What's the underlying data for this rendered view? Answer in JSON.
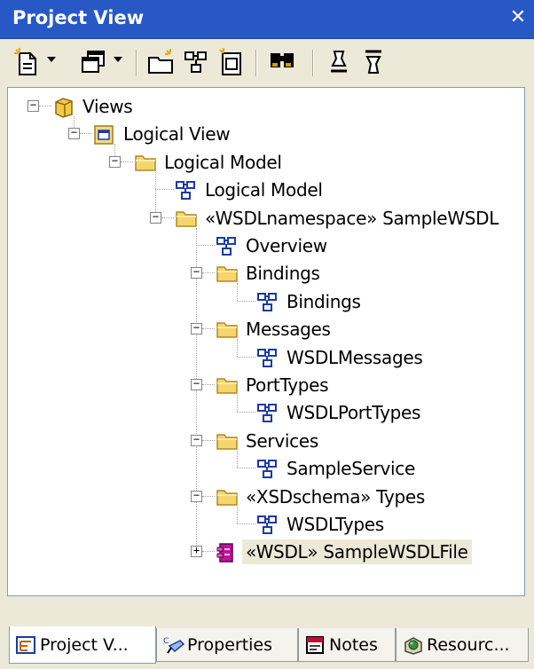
{
  "window": {
    "title": "Project View",
    "close_glyph": "✕"
  },
  "toolbar": {
    "items": [
      {
        "icon": "new-document-icon"
      },
      {
        "icon": "windows-icon"
      },
      {
        "icon": "new-package-icon"
      },
      {
        "icon": "new-diagram-icon"
      },
      {
        "icon": "new-element-icon"
      },
      {
        "icon": "find-icon"
      },
      {
        "icon": "move-up-icon"
      },
      {
        "icon": "move-down-icon"
      }
    ]
  },
  "tree": {
    "nodes": [
      {
        "label": "Views",
        "icon": "views-package-icon",
        "expander": "minus"
      },
      {
        "label": "Logical View",
        "icon": "logical-view-icon",
        "expander": "minus"
      },
      {
        "label": "Logical Model",
        "icon": "folder-icon",
        "expander": "minus"
      },
      {
        "label": "Logical Model",
        "icon": "diagram-icon",
        "expander": "none"
      },
      {
        "label": "«WSDLnamespace» SampleWSDL",
        "icon": "folder-icon",
        "expander": "minus"
      },
      {
        "label": "Overview",
        "icon": "diagram-icon",
        "expander": "none"
      },
      {
        "label": "Bindings",
        "icon": "folder-icon",
        "expander": "minus"
      },
      {
        "label": "Bindings",
        "icon": "diagram-icon",
        "expander": "none"
      },
      {
        "label": "Messages",
        "icon": "folder-icon",
        "expander": "minus"
      },
      {
        "label": "WSDLMessages",
        "icon": "diagram-icon",
        "expander": "none"
      },
      {
        "label": "PortTypes",
        "icon": "folder-icon",
        "expander": "minus"
      },
      {
        "label": "WSDLPortTypes",
        "icon": "diagram-icon",
        "expander": "none"
      },
      {
        "label": "Services",
        "icon": "folder-icon",
        "expander": "minus"
      },
      {
        "label": "SampleService",
        "icon": "diagram-icon",
        "expander": "none"
      },
      {
        "label": "«XSDschema» Types",
        "icon": "folder-icon",
        "expander": "minus"
      },
      {
        "label": "WSDLTypes",
        "icon": "diagram-icon",
        "expander": "none"
      },
      {
        "label": "«WSDL» SampleWSDLFile",
        "icon": "wsdl-file-icon",
        "expander": "plus",
        "selected": true
      }
    ]
  },
  "tabs": [
    {
      "label": "Project V...",
      "icon": "project-view-icon",
      "active": true
    },
    {
      "label": "Properties",
      "icon": "properties-icon",
      "active": false
    },
    {
      "label": "Notes",
      "icon": "notes-icon",
      "active": false
    },
    {
      "label": "Resourc...",
      "icon": "resources-icon",
      "active": false
    }
  ],
  "colors": {
    "titlebar": "#2758c6",
    "folder": "#f5d56e",
    "diagram": "#1a3aa8",
    "wsdl": "#c0149c",
    "selection": "#ece9d8"
  }
}
